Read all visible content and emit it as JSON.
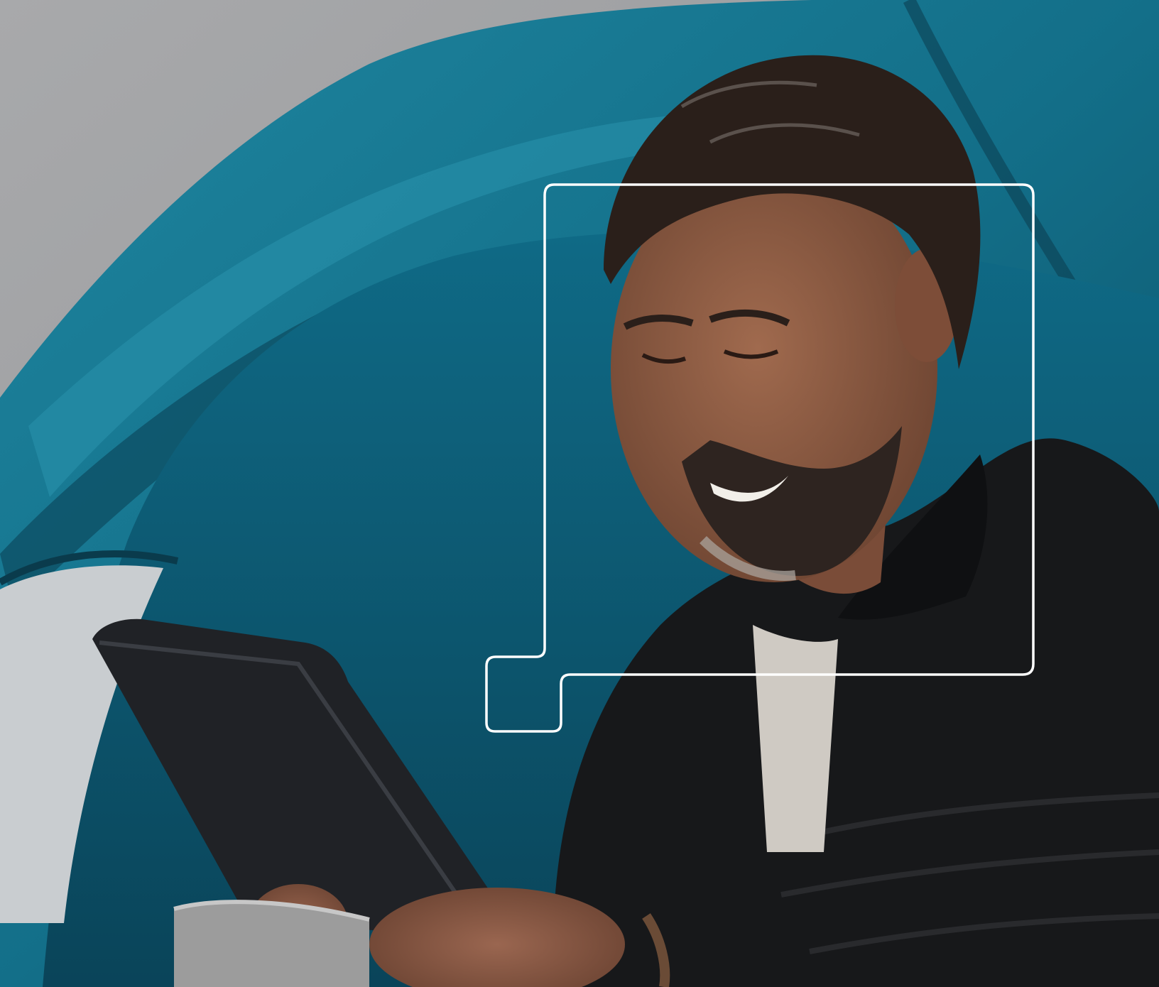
{
  "scene": {
    "colors": {
      "sky": "#a3a4a6",
      "tent_light": "#1d7e98",
      "tent_mid": "#126a83",
      "tent_dark": "#0c4f66",
      "tent_interior": "#0d5a73",
      "jacket": "#17181a",
      "skin": "#8a5a44",
      "hair": "#2a1f1a",
      "tablet": "#202226",
      "mug": "#9a9a9a",
      "frame_outline": "#ffffff"
    },
    "icons": [
      "focus-frame-outline"
    ]
  }
}
